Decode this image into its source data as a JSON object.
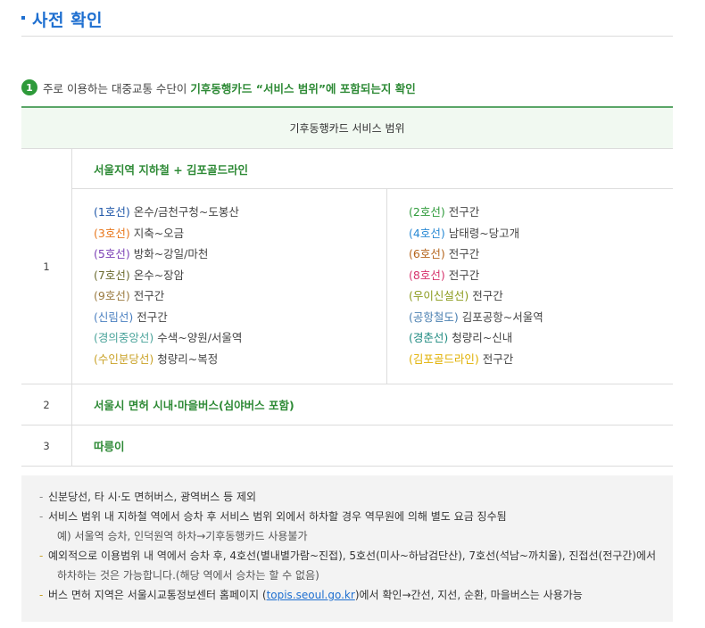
{
  "header": {
    "title": "사전 확인"
  },
  "subtitle": {
    "badge": "1",
    "text": "주로 이용하는 대중교통 수단이",
    "highlight": "기후동행카드 “서비스 범위”에 포함되는지 확인"
  },
  "table": {
    "header": "기후동행카드 서비스 범위",
    "row1": {
      "num": "1",
      "title": "서울지역 지하철 + 김포골드라인",
      "left": [
        {
          "name": "(1호선)",
          "desc": " 온수/금천구청~도봉산",
          "color": "#1e56a8"
        },
        {
          "name": "(3호선)",
          "desc": " 지축~오금",
          "color": "#e8761b"
        },
        {
          "name": "(5호선)",
          "desc": " 방화~강일/마천",
          "color": "#7b3fb5"
        },
        {
          "name": "(7호선)",
          "desc": " 온수~장암",
          "color": "#6b6b2f"
        },
        {
          "name": "(9호선)",
          "desc": " 전구간",
          "color": "#9a7a40"
        },
        {
          "name": "(신림선)",
          "desc": " 전구간",
          "color": "#4a7fc0"
        },
        {
          "name": "(경의중앙선)",
          "desc": " 수색~양원/서울역",
          "color": "#4aa39a"
        },
        {
          "name": "(수인분당선)",
          "desc": " 청량리~복정",
          "color": "#c9a227"
        }
      ],
      "right": [
        {
          "name": "(2호선)",
          "desc": " 전구간",
          "color": "#2e9a3a"
        },
        {
          "name": "(4호선)",
          "desc": " 남태령~당고개",
          "color": "#2a8ad4"
        },
        {
          "name": "(6호선)",
          "desc": " 전구간",
          "color": "#b5651d"
        },
        {
          "name": "(8호선)",
          "desc": " 전구간",
          "color": "#d6336c"
        },
        {
          "name": "(우이신설선)",
          "desc": " 전구간",
          "color": "#8a9a1b"
        },
        {
          "name": "(공항철도)",
          "desc": " 김포공항~서울역",
          "color": "#4a7fb0"
        },
        {
          "name": "(경춘선)",
          "desc": " 청량리~신내",
          "color": "#1f8a80"
        },
        {
          "name": "(김포골드라인)",
          "desc": " 전구간",
          "color": "#e0b000"
        }
      ]
    },
    "row2": {
      "num": "2",
      "title": "서울시 면허 시내·마을버스(심야버스 포함)"
    },
    "row3": {
      "num": "3",
      "title": "따릉이"
    }
  },
  "notes": {
    "n1": "신분당선, 타 시·도 면허버스, 광역버스 등 제외",
    "n2": "서비스 범위 내 지하철 역에서 승차 후 서비스 범위 외에서 하차할 경우 역무원에 의해 별도 요금 징수됨",
    "n2_sub": "예) 서울역 승차, 인덕원역 하차→기후동행카드 사용불가",
    "n3_line1": "예외적으로 이용범위 내 역에서 승차 후, 4호선(별내별가람~진접), 5호선(미사~하남검단산), 7호선(석남~까치울), 진접선(전구간)에서",
    "n3_line2": "하차하는 것은 가능합니다.(해당 역에서 승차는 할 수 없음)",
    "n4_pre": "버스 면허 지역은 서울시교통정보센터 홈페이지 (",
    "n4_link": "topis.seoul.go.kr",
    "n4_post": ")에서 확인→간선, 지선, 순환, 마을버스는 사용가능"
  }
}
